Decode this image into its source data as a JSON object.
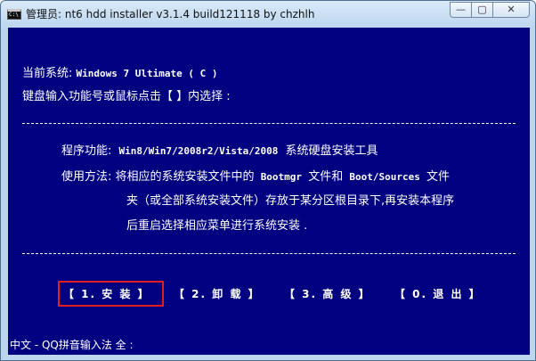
{
  "window": {
    "title": "管理员: nt6 hdd installer v3.1.4 build121118 by chzhlh",
    "icon_text": "C:\\",
    "caption_buttons": {
      "minimize": "—",
      "maximize": "▢",
      "close": "✕"
    }
  },
  "console": {
    "current_system_label": "当前系统:",
    "current_system_value": "Windows 7 Ultimate  ( C )",
    "prompt": "键盘输入功能号或鼠标点击【 】内选择 :",
    "program_label": "程序功能:",
    "program_value_en": "Win8/Win7/2008r2/Vista/2008",
    "program_value_cn": "系统硬盘安装工具",
    "usage_label": "使用方法:",
    "usage_line1_a": "将相应的系统安装文件中的",
    "usage_line1_b": "Bootmgr",
    "usage_line1_c": "文件和",
    "usage_line1_d": "Boot/Sources",
    "usage_line1_e": "文件",
    "usage_line2": "夹（或全部系统安装文件）存放于某分区根目录下,再安装本程序",
    "usage_line3": "后重启选择相应菜单进行系统安装 ."
  },
  "menu": [
    {
      "label": "【 1. 安 装  】"
    },
    {
      "label": "【 2. 卸 载  】"
    },
    {
      "label": "【 3. 高 级  】"
    },
    {
      "label": "【 0. 退 出  】"
    }
  ],
  "statusbar": {
    "ime": "中文 - QQ拼音输入法 全 :"
  }
}
